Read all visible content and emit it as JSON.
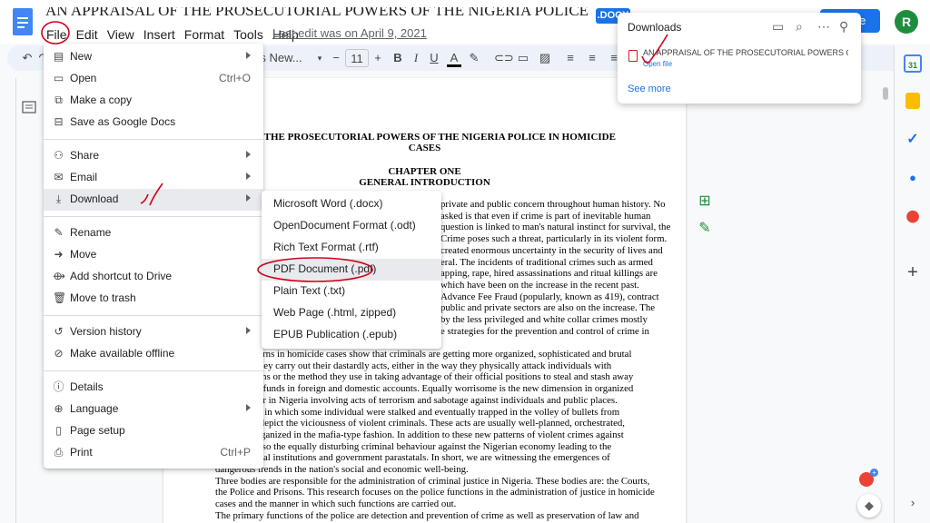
{
  "header": {
    "doc_title": "AN APPRAISAL OF THE PROSECUTORIAL POWERS OF THE NIGERIA POLICE IN HOMICIDE CASES",
    "file_chip": ".DOCX",
    "share_label": "Share",
    "avatar_letter": "R",
    "menus": [
      "File",
      "Edit",
      "View",
      "Insert",
      "Format",
      "Tools",
      "Help"
    ],
    "last_edit": "Last edit was on April 9, 2021"
  },
  "toolbar": {
    "font": "Times New...",
    "size": "11"
  },
  "file_menu": {
    "items": [
      {
        "label": "New",
        "icon": "document-icon",
        "glyph": "▤",
        "has_submenu": true,
        "shortcut": ""
      },
      {
        "label": "Open",
        "icon": "folder-icon",
        "glyph": "▭",
        "has_submenu": false,
        "shortcut": "Ctrl+O"
      },
      {
        "label": "Make a copy",
        "icon": "copy-icon",
        "glyph": "⧉",
        "has_submenu": false,
        "shortcut": ""
      },
      {
        "label": "Save as Google Docs",
        "icon": "save-icon",
        "glyph": "⊟",
        "has_submenu": false,
        "shortcut": ""
      },
      {
        "label": "Share",
        "icon": "person-add-icon",
        "glyph": "⚇",
        "has_submenu": true,
        "shortcut": ""
      },
      {
        "label": "Email",
        "icon": "email-icon",
        "glyph": "✉",
        "has_submenu": true,
        "shortcut": ""
      },
      {
        "label": "Download",
        "icon": "download-icon",
        "glyph": "⤓",
        "has_submenu": true,
        "shortcut": ""
      },
      {
        "label": "Rename",
        "icon": "rename-icon",
        "glyph": "✎",
        "has_submenu": false,
        "shortcut": ""
      },
      {
        "label": "Move",
        "icon": "move-icon",
        "glyph": "➜",
        "has_submenu": false,
        "shortcut": ""
      },
      {
        "label": "Add shortcut to Drive",
        "icon": "drive-shortcut-icon",
        "glyph": "⟴",
        "has_submenu": false,
        "shortcut": ""
      },
      {
        "label": "Move to trash",
        "icon": "trash-icon",
        "glyph": "🗑",
        "has_submenu": false,
        "shortcut": ""
      },
      {
        "label": "Version history",
        "icon": "history-icon",
        "glyph": "↺",
        "has_submenu": true,
        "shortcut": ""
      },
      {
        "label": "Make available offline",
        "icon": "offline-icon",
        "glyph": "⊘",
        "has_submenu": false,
        "shortcut": ""
      },
      {
        "label": "Details",
        "icon": "info-icon",
        "glyph": "ⓘ",
        "has_submenu": false,
        "shortcut": ""
      },
      {
        "label": "Language",
        "icon": "globe-icon",
        "glyph": "⊕",
        "has_submenu": true,
        "shortcut": ""
      },
      {
        "label": "Page setup",
        "icon": "page-setup-icon",
        "glyph": "▯",
        "has_submenu": false,
        "shortcut": ""
      },
      {
        "label": "Print",
        "icon": "print-icon",
        "glyph": "⎙",
        "has_submenu": false,
        "shortcut": "Ctrl+P"
      }
    ]
  },
  "download_menu": {
    "items": [
      "Microsoft Word (.docx)",
      "OpenDocument Format (.odt)",
      "Rich Text Format (.rtf)",
      "PDF Document (.pdf)",
      "Plain Text (.txt)",
      "Web Page (.html, zipped)",
      "EPUB Publication (.epub)"
    ]
  },
  "downloads_panel": {
    "title": "Downloads",
    "file_name": "AN APPRAISAL OF THE PROSECUTORIAL POWERS O...",
    "open_file": "Open file",
    "see_more": "See more"
  },
  "document": {
    "title_line1": "SE OF THE PROSECUTORIAL POWERS OF THE NIGERIA POLICE IN HOMICIDE",
    "title_line2": "CASES",
    "chapter": "CHAPTER ONE",
    "section": "GENERAL INTRODUCTION",
    "right_lines": [
      "private and public concern throughout human history. No",
      "asked is that even if crime is part of inevitable human",
      "question is linked to man's natural instinct for survival, the",
      "Crime poses such a threat, particularly in its violent form.",
      "created enormous uncertainty in the security of lives and",
      "eral. The incidents of traditional crimes such as armed",
      "apping, rape, hired assassinations and ritual killings are",
      "which have been on the increase in the recent past.",
      "Advance Fee Fraud (popularly, known as 419), contract",
      "public and private sectors are also on the increase. The",
      "by the less privileged and white collar crimes mostly",
      "e strategies for the prevention and control of crime in"
    ],
    "left_lines": [
      "g patterns in homicide cases show that criminals are getting more organized, sophisticated and brutal",
      "nner they carry out their dastardly acts, either in the way they physically attack individuals with",
      "weapons or the method they use in taking advantage of their official positions to steal and stash away",
      "public funds in foreign and domestic accounts. Equally worrisome is the new dimension in organized",
      "haviour in Nigeria involving acts of terrorism and sabotage against individuals and public places.",
      "idents, in which some individual were stalked and eventually trapped in the volley of bullets from",
      "pons, depict the viciousness of violent criminals. These acts are usually well-planned, orchestrated,",
      "and organized in the mafia-type fashion. In addition to these new patterns of violent crimes against",
      "re is also the equally disturbing criminal behaviour against the Nigerian economy leading to the",
      "financial institutions and government parastatals. In short, we are witnessing the emergences of"
    ],
    "full_lines": [
      "dangerous trends in the nation's social and economic well-being.",
      "Three bodies are responsible for the administration of criminal justice in Nigeria. These bodies are: the Courts,",
      "the Police and Prisons. This research focuses on the police functions in the administration of justice in homicide",
      "cases and the manner in which such functions are carried out.",
      " The primary functions of the police are detection and prevention of crime as well as preservation of law and"
    ]
  }
}
